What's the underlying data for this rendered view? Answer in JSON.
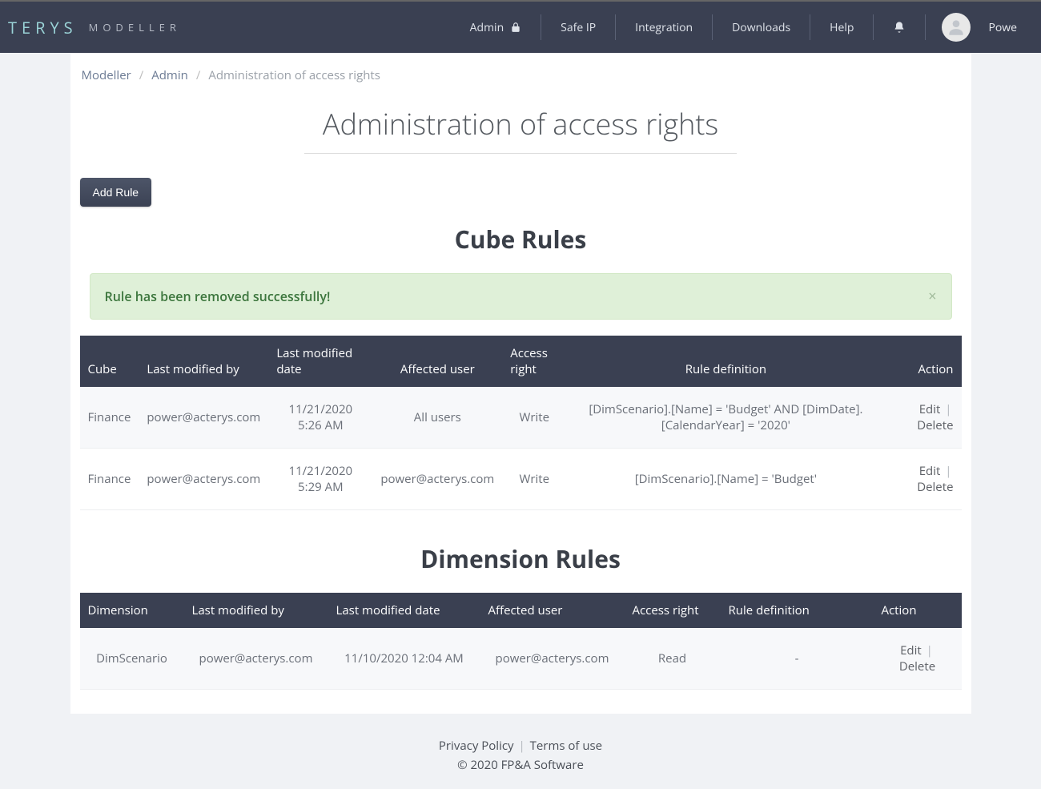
{
  "brand": {
    "logo": "TERYS",
    "sub": "MODELLER"
  },
  "nav": {
    "admin": "Admin",
    "safe_ip": "Safe IP",
    "integration": "Integration",
    "downloads": "Downloads",
    "help": "Help",
    "user": "Powe"
  },
  "breadcrumb": {
    "items": [
      "Modeller",
      "Admin",
      "Administration of access rights"
    ]
  },
  "page": {
    "title": "Administration of access rights",
    "add_rule_label": "Add Rule"
  },
  "alert": {
    "message": "Rule has been removed successfully!"
  },
  "cube_rules": {
    "title": "Cube Rules",
    "columns": {
      "cube": "Cube",
      "modified_by": "Last modified by",
      "modified_date": "Last modified date",
      "affected_user": "Affected user",
      "access_right": "Access right",
      "rule_def": "Rule definition",
      "action": "Action"
    },
    "rows": [
      {
        "cube": "Finance",
        "modified_by": "power@acterys.com",
        "modified_date": "11/21/2020 5:26 AM",
        "affected_user": "All users",
        "access_right": "Write",
        "rule_def": "[DimScenario].[Name] = 'Budget' AND [DimDate].[CalendarYear] = '2020'"
      },
      {
        "cube": "Finance",
        "modified_by": "power@acterys.com",
        "modified_date": "11/21/2020 5:29 AM",
        "affected_user": "power@acterys.com",
        "access_right": "Write",
        "rule_def": "[DimScenario].[Name] = 'Budget'"
      }
    ],
    "actions": {
      "edit": "Edit",
      "delete": "Delete"
    }
  },
  "dimension_rules": {
    "title": "Dimension Rules",
    "columns": {
      "dimension": "Dimension",
      "modified_by": "Last modified by",
      "modified_date": "Last modified date",
      "affected_user": "Affected user",
      "access_right": "Access right",
      "rule_def": "Rule definition",
      "action": "Action"
    },
    "rows": [
      {
        "dimension": "DimScenario",
        "modified_by": "power@acterys.com",
        "modified_date": "11/10/2020 12:04 AM",
        "affected_user": "power@acterys.com",
        "access_right": "Read",
        "rule_def": "-"
      }
    ],
    "actions": {
      "edit": "Edit",
      "delete": "Delete"
    }
  },
  "footer": {
    "privacy": "Privacy Policy",
    "terms": "Terms of use",
    "copyright": "© 2020 FP&A Software"
  }
}
